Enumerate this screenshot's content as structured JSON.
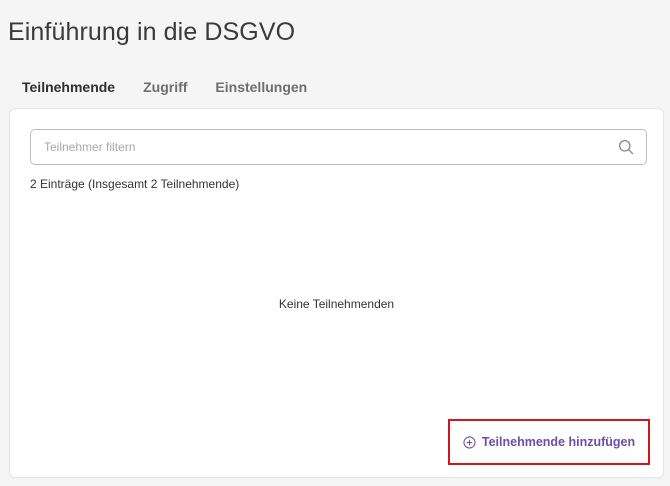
{
  "page": {
    "title": "Einführung in die DSGVO"
  },
  "tabs": [
    {
      "label": "Teilnehmende",
      "active": true
    },
    {
      "label": "Zugriff",
      "active": false
    },
    {
      "label": "Einstellungen",
      "active": false
    }
  ],
  "search": {
    "placeholder": "Teilnehmer filtern",
    "value": "",
    "icon": "search-icon"
  },
  "list": {
    "count_text": "2 Einträge (Insgesamt 2 Teilnehmende)",
    "empty_text": "Keine Teilnehmenden"
  },
  "actions": {
    "add_label": "Teilnehmende hinzufügen",
    "add_icon": "plus-circle-icon"
  },
  "colors": {
    "accent": "#6b4ea6",
    "highlight_border": "#d0161b",
    "background": "#f5f5f5"
  }
}
